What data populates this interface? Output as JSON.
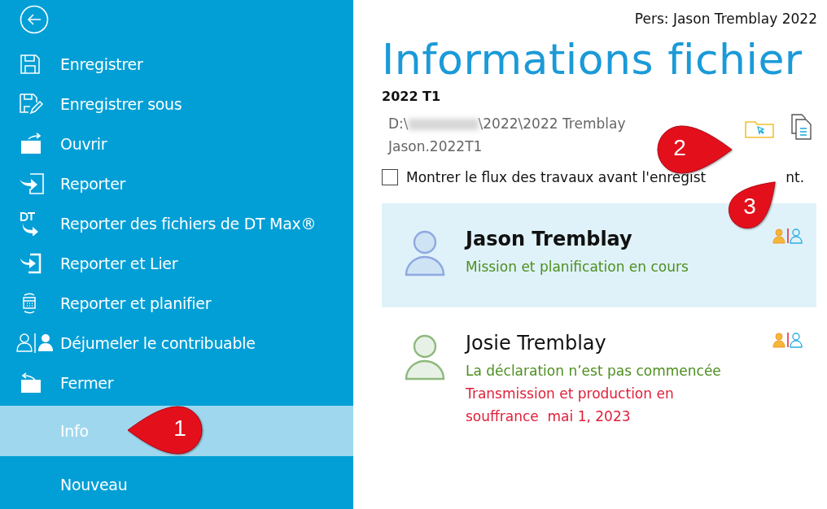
{
  "sidebar": {
    "items": [
      {
        "label": "Enregistrer",
        "selected": false
      },
      {
        "label": "Enregistrer sous",
        "selected": false
      },
      {
        "label": "Ouvrir",
        "selected": false
      },
      {
        "label": "Reporter",
        "selected": false
      },
      {
        "label": "Reporter des fichiers de DT Max®",
        "selected": false
      },
      {
        "label": "Reporter et Lier",
        "selected": false
      },
      {
        "label": "Reporter et planifier",
        "selected": false
      },
      {
        "label": "Déjumeler le contribuable",
        "selected": false
      },
      {
        "label": "Fermer",
        "selected": false
      },
      {
        "label": "Info",
        "selected": true
      },
      {
        "label": "Nouveau",
        "selected": false
      }
    ]
  },
  "header": {
    "title": "Pers: Jason Tremblay 2022"
  },
  "page": {
    "heading": "Informations fichier",
    "file_label": "2022 T1",
    "path_start": "D:\\",
    "path_end": "\\2022\\2022 Tremblay",
    "path_line2": "Jason.2022T1",
    "checkbox": {
      "label": "Montrer le flux des travaux avant l'enregist",
      "label_tail": "nt.",
      "checked": false
    }
  },
  "persons": [
    {
      "name": "Jason Tremblay",
      "selected": true,
      "color": "#8ea8e0",
      "statuses": [
        {
          "text": "Mission et planification en cours",
          "color": "#4e8f1f"
        }
      ]
    },
    {
      "name": "Josie Tremblay",
      "selected": false,
      "color": "#8db97e",
      "statuses": [
        {
          "text": "La déclaration n’est pas commencée",
          "color": "#4e8f1f"
        },
        {
          "text": "Transmission et production en souffrance  mai 1, 2023",
          "color": "#e0203a"
        }
      ]
    }
  ],
  "callouts": [
    {
      "number": "1"
    },
    {
      "number": "2"
    },
    {
      "number": "3"
    }
  ]
}
